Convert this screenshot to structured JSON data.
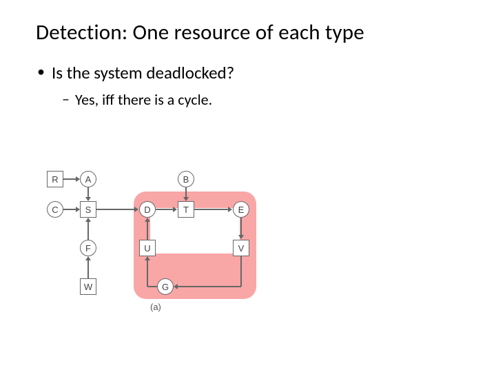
{
  "title": "Detection: One resource of each type",
  "bullets": {
    "level1": "Is the system deadlocked?",
    "level2": "Yes, iff there is a cycle."
  },
  "nodes": {
    "R": "R",
    "A": "A",
    "B": "B",
    "C": "C",
    "S": "S",
    "D": "D",
    "T": "T",
    "E": "E",
    "F": "F",
    "U": "U",
    "V": "V",
    "W": "W",
    "G": "G"
  },
  "caption": "(a)",
  "chart_data": {
    "type": "diagram",
    "description": "Resource-allocation graph. Circles = processes, squares = resources. An edge resource→process means the resource is held by that process; an edge process→resource means the process is requesting that resource. The highlighted cycle D→T→E→V→G→U→D indicates a deadlock.",
    "processes": [
      "A",
      "B",
      "C",
      "D",
      "E",
      "F",
      "G"
    ],
    "resources": [
      "R",
      "S",
      "T",
      "U",
      "V",
      "W"
    ],
    "edges": [
      {
        "from": "R",
        "to": "A",
        "type": "held"
      },
      {
        "from": "A",
        "to": "S",
        "type": "request"
      },
      {
        "from": "C",
        "to": "S",
        "type": "request"
      },
      {
        "from": "F",
        "to": "S",
        "type": "request"
      },
      {
        "from": "W",
        "to": "F",
        "type": "held"
      },
      {
        "from": "S",
        "to": "D",
        "type": "held"
      },
      {
        "from": "B",
        "to": "T",
        "type": "request"
      },
      {
        "from": "D",
        "to": "T",
        "type": "request"
      },
      {
        "from": "T",
        "to": "E",
        "type": "held"
      },
      {
        "from": "E",
        "to": "V",
        "type": "request"
      },
      {
        "from": "V",
        "to": "G",
        "type": "held"
      },
      {
        "from": "G",
        "to": "U",
        "type": "request"
      },
      {
        "from": "U",
        "to": "D",
        "type": "held"
      }
    ],
    "deadlock_cycle": [
      "D",
      "T",
      "E",
      "V",
      "G",
      "U",
      "D"
    ]
  }
}
